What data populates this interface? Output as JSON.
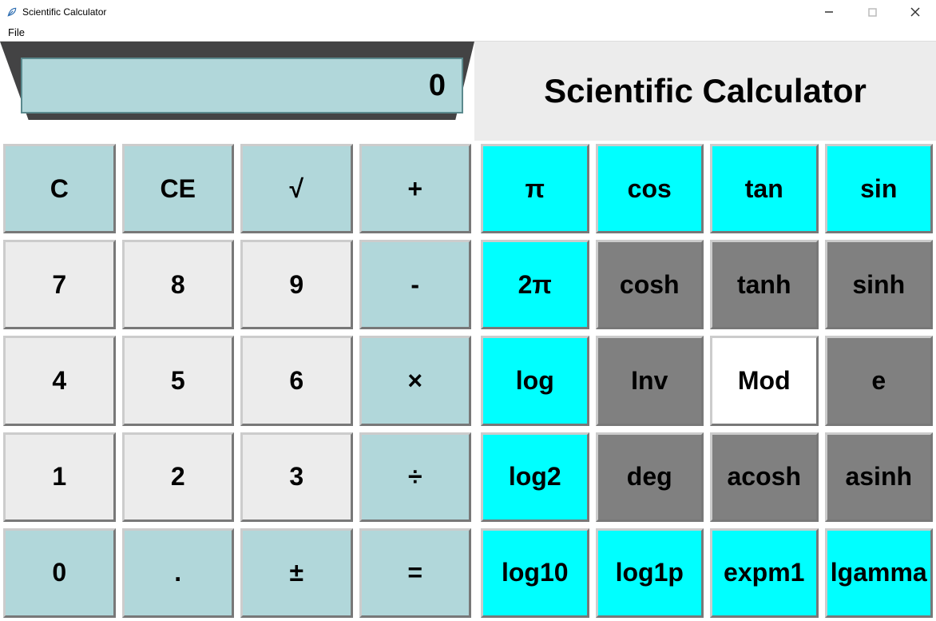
{
  "window": {
    "title": "Scientific Calculator"
  },
  "menu": {
    "file": "File"
  },
  "display": {
    "value": "0"
  },
  "header": {
    "title": "Scientific Calculator"
  },
  "left_grid": {
    "r0": {
      "c0": "C",
      "c1": "CE",
      "c2": "√",
      "c3": "+"
    },
    "r1": {
      "c0": "7",
      "c1": "8",
      "c2": "9",
      "c3": "-"
    },
    "r2": {
      "c0": "4",
      "c1": "5",
      "c2": "6",
      "c3": "×"
    },
    "r3": {
      "c0": "1",
      "c1": "2",
      "c2": "3",
      "c3": "÷"
    },
    "r4": {
      "c0": "0",
      "c1": ".",
      "c2": "±",
      "c3": "="
    }
  },
  "right_grid": {
    "r0": {
      "c0": "π",
      "c1": "cos",
      "c2": "tan",
      "c3": "sin"
    },
    "r1": {
      "c0": "2π",
      "c1": "cosh",
      "c2": "tanh",
      "c3": "sinh"
    },
    "r2": {
      "c0": "log",
      "c1": "Inv",
      "c2": "Mod",
      "c3": "e"
    },
    "r3": {
      "c0": "log2",
      "c1": "deg",
      "c2": "acosh",
      "c3": "asinh"
    },
    "r4": {
      "c0": "log10",
      "c1": "log1p",
      "c2": "expm1",
      "c3": "lgamma"
    }
  },
  "colors": {
    "powder_blue": "#b1d7da",
    "light_gray": "#ececec",
    "cyan": "#00ffff",
    "dark_gray": "#808080",
    "white": "#ffffff"
  }
}
